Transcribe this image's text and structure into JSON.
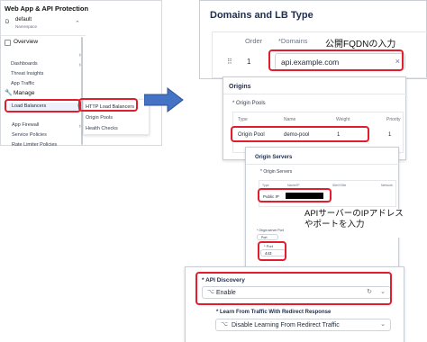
{
  "sidebar": {
    "app_title": "Web App & API Protection",
    "namespace_avatar": "D",
    "namespace_name": "default",
    "namespace_sub": "Namespace",
    "section_overview": "Overview",
    "overview_items": [
      "Dashboards",
      "Threat Insights",
      "App Traffic"
    ],
    "section_manage": "Manage",
    "manage_items": [
      "Load Balancers",
      "App Firewall",
      "Service Policies",
      "Rate Limiter Policies"
    ],
    "flyout_items": [
      "HTTP Load Balancers",
      "Origin Pools",
      "Health Checks"
    ]
  },
  "domains": {
    "title": "Domains and LB Type",
    "col_order": "Order",
    "col_domains": "*Domains",
    "row_order": "1",
    "domain_value": "api.example.com",
    "annotation": "公開FQDNの入力"
  },
  "origins": {
    "title": "Origins",
    "subtitle": "* Origin Pools",
    "columns": [
      "Type",
      "Name",
      "Weight",
      "Priority"
    ],
    "row": [
      "Origin Pool",
      "demo-pool",
      "1",
      "1"
    ]
  },
  "origin_servers": {
    "title": "Origin Servers",
    "subtitle": "* Origin Servers",
    "columns": [
      "Type",
      "Name/IP",
      "Site/VSite",
      "Network"
    ],
    "row_type": "Public IP",
    "port_section": "* Origin server Port",
    "port_select": "Port",
    "port_label": "* Port",
    "port_value": "443",
    "annotation_line1": "APIサーバーのIPアドレス",
    "annotation_line2": "やポートを入力"
  },
  "api": {
    "discovery_label": "* API Discovery",
    "discovery_value": "Enable",
    "learn_label": "* Learn From Traffic With Redirect Response",
    "learn_value": "Disable Learning From Redirect Traffic"
  },
  "colors": {
    "highlight": "#e11d2e",
    "arrow": "#4472c4",
    "active_row": "#eef1fb"
  }
}
